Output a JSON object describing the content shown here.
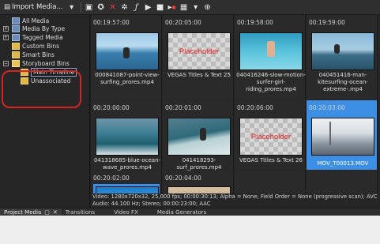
{
  "toolbar": {
    "import_label": "Import Media...",
    "icons": [
      "import-media-icon",
      "dropdown-icon",
      "capture-icon",
      "remove-icon",
      "delete-icon",
      "properties-icon",
      "fx-icon",
      "play-icon",
      "stop-icon",
      "auto-preview-icon",
      "views-icon",
      "views-dropdown-icon",
      "zoom-icon"
    ]
  },
  "tree": {
    "items": [
      {
        "label": "All Media"
      },
      {
        "label": "Media By Type"
      },
      {
        "label": "Tagged Media"
      },
      {
        "label": "Custom Bins"
      },
      {
        "label": "Smart Bins"
      },
      {
        "label": "Storyboard Bins"
      },
      {
        "label": "Main Timeline"
      },
      {
        "label": "Unassociated"
      }
    ]
  },
  "grid": {
    "cells": [
      {
        "tc": "00:19:57:00",
        "name": "000841087-point-view-surfing_prores.mp4",
        "thumb": "surf-water"
      },
      {
        "tc": "00:20:05:00",
        "name": "VEGAS Titles & Text 25",
        "thumb": "placeholder",
        "placeholder_text": "Placeholder"
      },
      {
        "tc": "00:19:58:00",
        "name": "040416246-slow-motion-surfer-girl-riding_prores.mp4",
        "thumb": "surfer-girl"
      },
      {
        "tc": "00:19:59:00",
        "name": "040451416-man-kitesurfing-ocean-extreme-.mp4",
        "thumb": "kitesurf"
      },
      {
        "tc": "00:20:00:00",
        "name": "041318685-blue-ocean-wave_prores.mp4",
        "thumb": "wave"
      },
      {
        "tc": "00:20:01:00",
        "name": "041418293-surf_prores.mp4",
        "thumb": "surf"
      },
      {
        "tc": "00:20:06:00",
        "name": "VEGAS Titles & Text 26",
        "thumb": "placeholder",
        "placeholder_text": "Placeholder"
      },
      {
        "tc": "00:20:03:00",
        "name": "MOV_T00013.MOV",
        "thumb": "stadium",
        "selected": true
      },
      {
        "tc": "00:20:02:00",
        "name": "",
        "thumb": "kid-water",
        "selected": true
      },
      {
        "tc": "00:20:04:00",
        "name": "",
        "thumb": "animal"
      }
    ]
  },
  "info": {
    "line1": "Video: 1280x720x32, 25,000 fps; 00:00:30:13; Alpha = None; Field Order = None (progressive scan); AVC",
    "line2": "Audio: 44.100 Hz; Stereo; 00:00:23:00; AAC"
  },
  "tabs": [
    {
      "label": "Project Media",
      "active": true
    },
    {
      "label": "Transitions"
    },
    {
      "label": "Video FX"
    },
    {
      "label": "Media Generators"
    }
  ],
  "colors": {
    "selection": "#3d8fe6",
    "highlight_outline": "#d8231f",
    "placeholder_text": "#e02424"
  }
}
